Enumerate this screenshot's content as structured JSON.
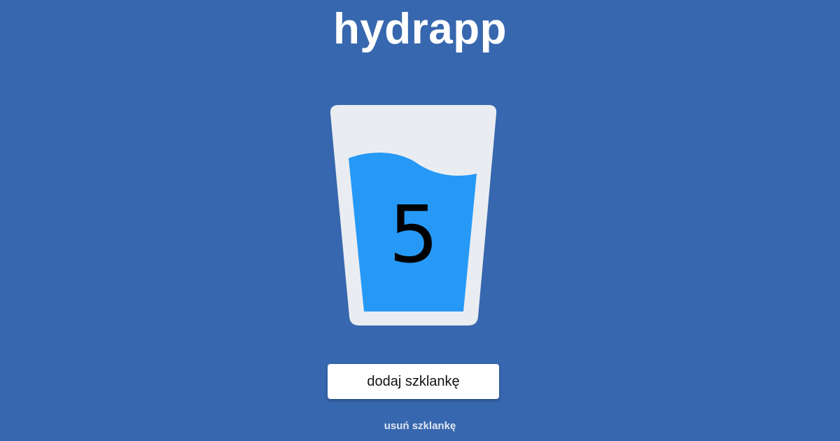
{
  "app": {
    "title": "hydrapp"
  },
  "glass": {
    "count": "5",
    "water_level": 0.86,
    "icon": "glass-of-water-icon"
  },
  "actions": {
    "add_label": "dodaj szklankę",
    "remove_label": "usuń szklankę"
  },
  "colors": {
    "background": "#3767ae",
    "glass": "#e9edf2",
    "water": "#2699f6",
    "button_background": "#ffffff",
    "text_light": "#ffffff"
  }
}
